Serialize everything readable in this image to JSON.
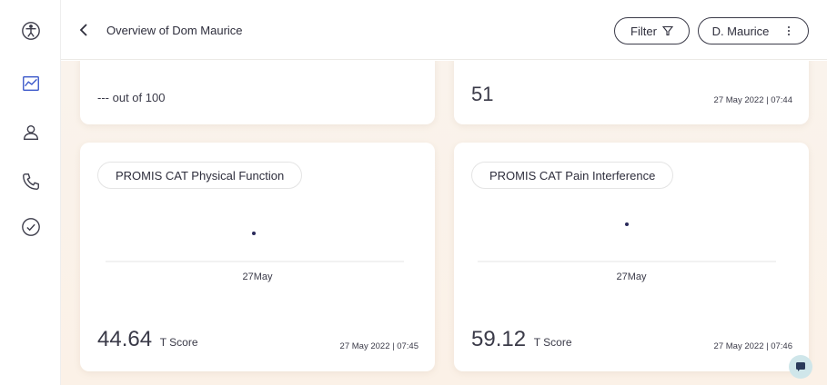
{
  "header": {
    "title": "Overview of Dom Maurice",
    "filter_label": "Filter",
    "user_label": "D. Maurice"
  },
  "sidebar": {
    "items": [
      {
        "icon": "accessibility-icon"
      },
      {
        "icon": "chart-icon",
        "active": true
      },
      {
        "icon": "person-icon"
      },
      {
        "icon": "phone-icon"
      },
      {
        "icon": "check-circle-icon"
      }
    ]
  },
  "top_cards": [
    {
      "value": "---",
      "suffix": "out of 100"
    },
    {
      "value": "51",
      "timestamp": "27 May 2022 | 07:44"
    }
  ],
  "cards": [
    {
      "title": "PROMIS CAT Physical Function",
      "x_label": "27May",
      "score": "44.64",
      "unit": "T Score",
      "timestamp": "27 May 2022 | 07:45"
    },
    {
      "title": "PROMIS CAT Pain Interference",
      "x_label": "27May",
      "score": "59.12",
      "unit": "T Score",
      "timestamp": "27 May 2022 | 07:46"
    }
  ],
  "colors": {
    "accent": "#2a2a5a",
    "active_icon": "#3a57c9",
    "background": "#faf3ec"
  }
}
